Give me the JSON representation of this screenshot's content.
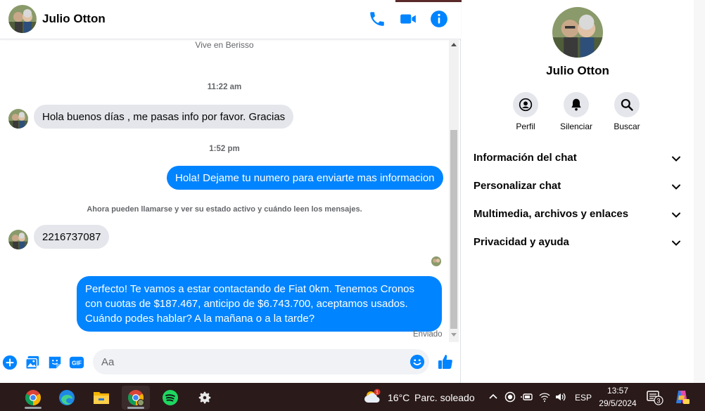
{
  "contact": {
    "name": "Julio Otton"
  },
  "chat": {
    "vive": "Vive en Berisso",
    "time1": "11:22 am",
    "msg1": "Hola buenos días , me pasas info por favor. Gracias",
    "time2": "1:52 pm",
    "msg2": "Hola! Dejame tu numero para enviarte mas informacion",
    "system_note": "Ahora pueden llamarse y ver su estado activo y cuándo leen los mensajes.",
    "msg3": "2216737087",
    "msg4": "Perfecto! Te vamos a estar contactando de Fiat 0km. Tenemos Cronos con cuotas de $187.467, anticipo de $6.743.700, aceptamos usados. Cuándo podes hablar? A la mañana o a la tarde?",
    "status": "Enviado"
  },
  "composer": {
    "placeholder": "Aa"
  },
  "panel": {
    "actions": [
      "Perfil",
      "Silenciar",
      "Buscar"
    ],
    "sections": [
      "Información del chat",
      "Personalizar chat",
      "Multimedia, archivos y enlaces",
      "Privacidad y ayuda"
    ]
  },
  "taskbar": {
    "weather": {
      "temp": "16°C",
      "desc": "Parc. soleado",
      "badge": "1"
    },
    "lang": "ESP",
    "time": "13:57",
    "date": "29/5/2024",
    "notifications": "3"
  },
  "colors": {
    "accent": "#0084ff",
    "incoming_bubble": "#e4e6eb",
    "taskbar": "#2b1a1a"
  }
}
